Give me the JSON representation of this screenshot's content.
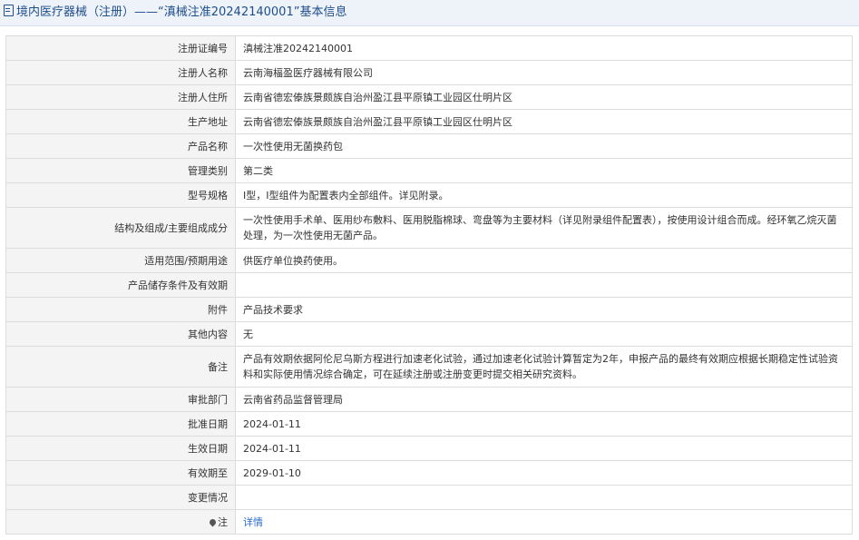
{
  "header": {
    "title": "境内医疗器械（注册）——“滇械注准20242140001”基本信息"
  },
  "rows": [
    {
      "label": "注册证编号",
      "value": "滇械注准20242140001"
    },
    {
      "label": "注册人名称",
      "value": "云南海楅盈医疗器械有限公司"
    },
    {
      "label": "注册人住所",
      "value": "云南省德宏傣族景颇族自治州盈江县平原镇工业园区仕明片区"
    },
    {
      "label": "生产地址",
      "value": "云南省德宏傣族景颇族自治州盈江县平原镇工业园区仕明片区"
    },
    {
      "label": "产品名称",
      "value": "一次性使用无菌换药包"
    },
    {
      "label": "管理类别",
      "value": "第二类"
    },
    {
      "label": "型号规格",
      "value": "Ⅰ型，Ⅰ型组件为配置表内全部组件。详见附录。"
    },
    {
      "label": "结构及组成/主要组成成分",
      "value": "一次性使用手术单、医用纱布敷料、医用脱脂棉球、弯盘等为主要材料（详见附录组件配置表），按使用设计组合而成。经环氧乙烷灭菌处理，为一次性使用无菌产品。"
    },
    {
      "label": "适用范围/预期用途",
      "value": "供医疗单位换药使用。"
    },
    {
      "label": "产品储存条件及有效期",
      "value": ""
    },
    {
      "label": "附件",
      "value": "产品技术要求"
    },
    {
      "label": "其他内容",
      "value": "无"
    },
    {
      "label": "备注",
      "value": "产品有效期依据阿伦尼乌斯方程进行加速老化试验，通过加速老化试验计算暂定为2年，申报产品的最终有效期应根据长期稳定性试验资料和实际使用情况综合确定，可在延续注册或注册变更时提交相关研究资料。"
    },
    {
      "label": "审批部门",
      "value": "云南省药品监督管理局"
    },
    {
      "label": "批准日期",
      "value": "2024-01-11"
    },
    {
      "label": "生效日期",
      "value": "2024-01-11"
    },
    {
      "label": "有效期至",
      "value": "2029-01-10"
    },
    {
      "label": "变更情况",
      "value": ""
    }
  ],
  "note": {
    "label": "注",
    "icon": "pin-icon",
    "link_text": "详情",
    "link_color": "#2a6cc8"
  },
  "colors": {
    "title_text": "#1f4e8c",
    "title_bg": "#eef3f9",
    "label_bg": "#f4f4f4",
    "border": "#dcdcdc"
  }
}
